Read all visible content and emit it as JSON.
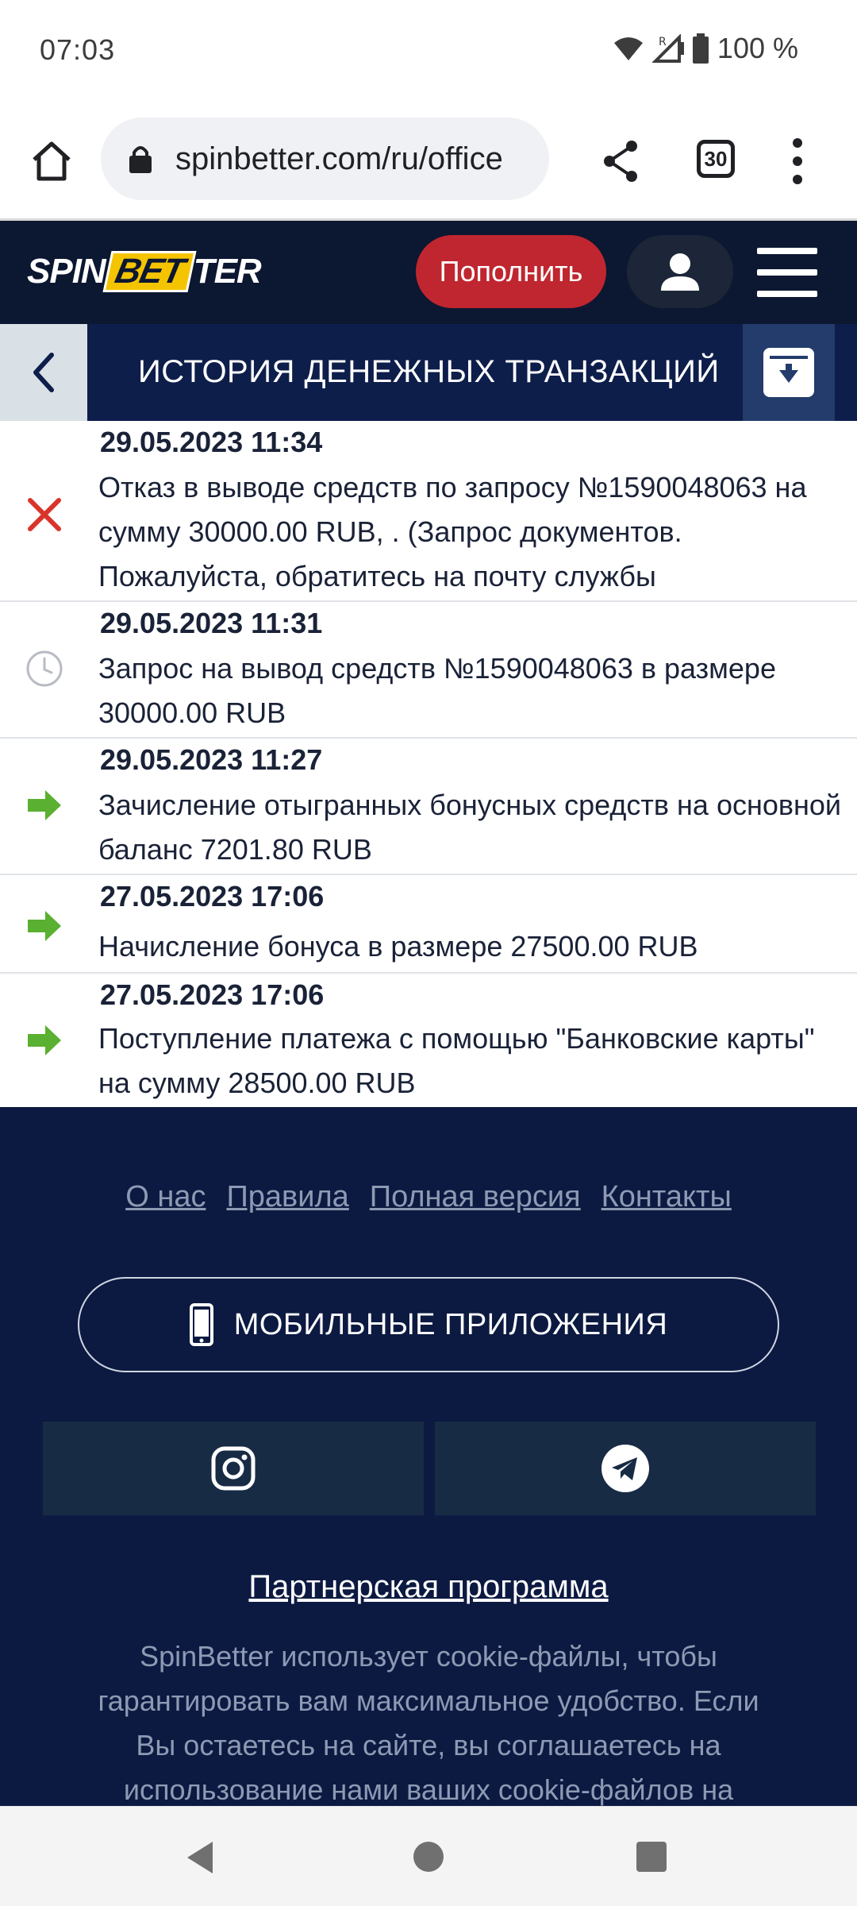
{
  "status_bar": {
    "time": "07:03",
    "battery": "100 %"
  },
  "browser": {
    "url": "spinbetter.com/ru/office",
    "tab_count": "30"
  },
  "header": {
    "logo": {
      "part1": "SPIN",
      "part2": "BET",
      "part3": "TER"
    },
    "deposit_label": "Пополнить"
  },
  "title_bar": {
    "title": "ИСТОРИЯ ДЕНЕЖНЫХ ТРАНЗАКЦИЙ"
  },
  "transactions": [
    {
      "date": "29.05.2023 11:34",
      "status": "rejected",
      "description": "Отказ в выводе средств по запросу №1590048063 на сумму 30000.00 RUB, . (Запрос документов. Пожалуйста, обратитесь на почту службы безопасности.)"
    },
    {
      "date": "29.05.2023 11:31",
      "status": "pending",
      "description": "Запрос на вывод средств №1590048063 в размере 30000.00 RUB"
    },
    {
      "date": "29.05.2023 11:27",
      "status": "incoming",
      "description": "Зачисление отыгранных бонусных средств на основной баланс 7201.80 RUB"
    },
    {
      "date": "27.05.2023 17:06",
      "status": "incoming",
      "description": "Начисление бонуса в размере 27500.00 RUB"
    },
    {
      "date": "27.05.2023 17:06",
      "status": "incoming",
      "description": "Поступление платежа с помощью \"Банковские карты\" на сумму 28500.00 RUB"
    }
  ],
  "footer": {
    "links": [
      "О нас",
      "Правила",
      "Полная версия",
      "Контакты"
    ],
    "apps_label": "МОБИЛЬНЫЕ ПРИЛОЖЕНИЯ",
    "partner_label": "Партнерская программа",
    "cookie_text": "SpinBetter использует cookie-файлы, чтобы гарантировать вам максимальное удобство. Если Вы остаетесь на сайте, вы соглашаетесь на использование нами ваших cookie-файлов на"
  },
  "colors": {
    "header_bg": "#0c1731",
    "title_bg": "#0e1e4b",
    "deposit": "#c0262f",
    "reject": "#d9342b",
    "incoming": "#5ab030",
    "footer_bg": "#0c1a42"
  }
}
